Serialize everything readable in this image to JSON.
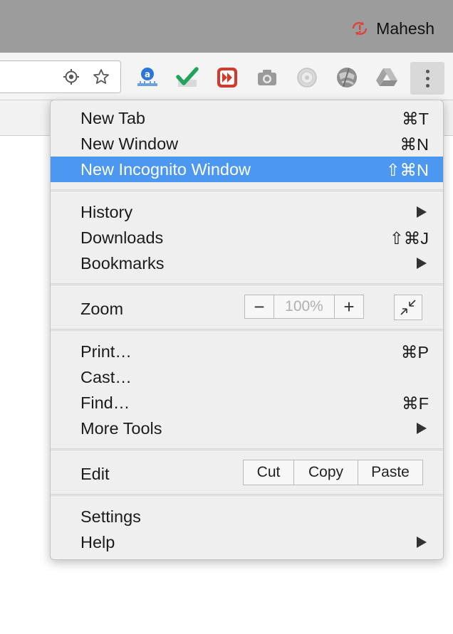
{
  "window": {
    "profile_name": "Mahesh"
  },
  "toolbar": {
    "extensions": [
      "amazon-assistant-icon",
      "checkmark-icon",
      "fast-forward-icon",
      "camera-icon",
      "circle-extension-icon",
      "globe-extension-icon",
      "drive-icon"
    ],
    "menu_button": "more-vertical-icon"
  },
  "menu": {
    "section1": {
      "new_tab": {
        "label": "New Tab",
        "shortcut": "⌘T"
      },
      "new_window": {
        "label": "New Window",
        "shortcut": "⌘N"
      },
      "new_incognito": {
        "label": "New Incognito Window",
        "shortcut": "⇧⌘N"
      }
    },
    "section2": {
      "history": {
        "label": "History"
      },
      "downloads": {
        "label": "Downloads",
        "shortcut": "⇧⌘J"
      },
      "bookmarks": {
        "label": "Bookmarks"
      }
    },
    "zoom": {
      "label": "Zoom",
      "minus": "−",
      "value": "100%",
      "plus": "+"
    },
    "section4": {
      "print": {
        "label": "Print…",
        "shortcut": "⌘P"
      },
      "cast": {
        "label": "Cast…"
      },
      "find": {
        "label": "Find…",
        "shortcut": "⌘F"
      },
      "more_tools": {
        "label": "More Tools"
      }
    },
    "edit": {
      "label": "Edit",
      "cut": "Cut",
      "copy": "Copy",
      "paste": "Paste"
    },
    "section6": {
      "settings": {
        "label": "Settings"
      },
      "help": {
        "label": "Help"
      }
    }
  },
  "colors": {
    "highlight": "#4c98f0",
    "titlebar": "#9c9c9c"
  }
}
